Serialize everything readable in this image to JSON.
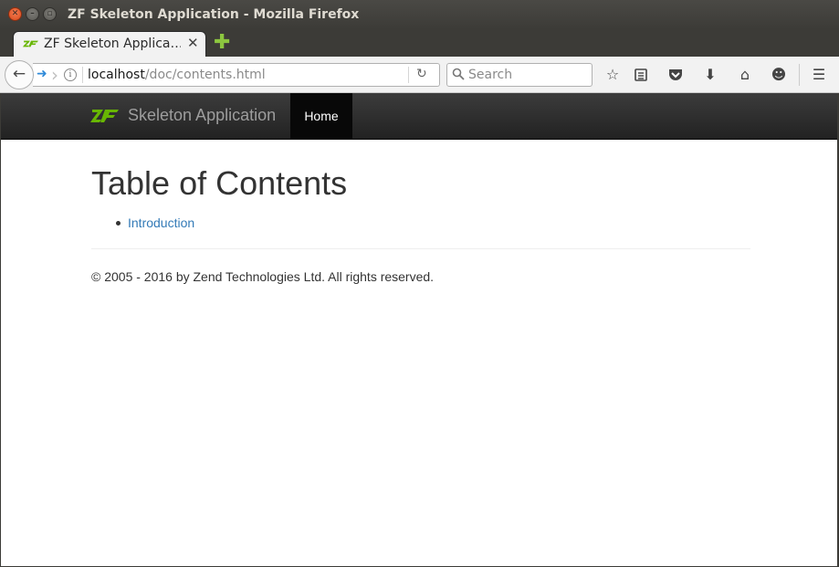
{
  "window": {
    "title": "ZF Skeleton Application - Mozilla Firefox",
    "close_glyph": "✕",
    "min_glyph": "–",
    "max_glyph": "▫"
  },
  "tab": {
    "title": "ZF Skeleton Applica…",
    "close_glyph": "✕",
    "new_tab_glyph": "✚"
  },
  "urlbar": {
    "host": "localhost",
    "path": "/doc/contents.html"
  },
  "searchbar": {
    "placeholder": "Search"
  },
  "toolbar": {
    "icons": [
      "bookmark-star-icon",
      "reading-list-icon",
      "pocket-icon",
      "download-icon",
      "home-icon",
      "smiley-icon",
      "hamburger-menu-icon"
    ]
  },
  "site": {
    "brand": "Skeleton Application",
    "nav": {
      "home_label": "Home"
    }
  },
  "main": {
    "title": "Table of Contents",
    "toc": [
      {
        "label": "Introduction"
      }
    ],
    "footer": "© 2005 - 2016 by Zend Technologies Ltd. All rights reserved."
  },
  "colors": {
    "link": "#337ab7",
    "navbar": "#222222",
    "brand_green": "#68b604"
  }
}
